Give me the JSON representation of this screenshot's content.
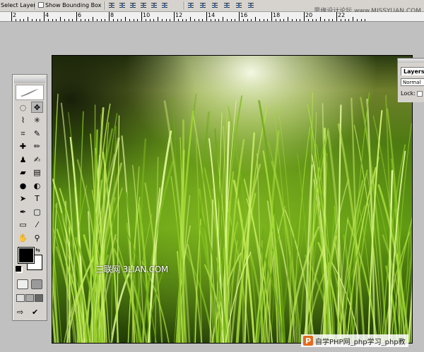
{
  "options_bar": {
    "select_layer_label": "Select Layer",
    "show_bounding_box_label": "Show Bounding Box"
  },
  "ruler": {
    "ticks": [
      "2",
      "4",
      "6",
      "8",
      "10",
      "12",
      "14",
      "16",
      "18",
      "20",
      "22"
    ]
  },
  "watermarks": {
    "top_right": "思缘设计论坛 www.MISSYUAN.COM",
    "canvas": "三联网 3LIAN.COM",
    "bottom_right": "自学PHP网_php学习_php教",
    "bottom_logo": "P"
  },
  "layers_panel": {
    "tab_label": "Layers",
    "blend_mode": "Normal",
    "lock_label": "Lock:"
  },
  "toolbox": {
    "tools": [
      {
        "name": "marquee-tool-icon",
        "glyph": "◌"
      },
      {
        "name": "move-tool-icon",
        "glyph": "✥"
      },
      {
        "name": "lasso-tool-icon",
        "glyph": "⌇"
      },
      {
        "name": "magic-wand-tool-icon",
        "glyph": "✳"
      },
      {
        "name": "crop-tool-icon",
        "glyph": "⌗"
      },
      {
        "name": "slice-tool-icon",
        "glyph": "✎"
      },
      {
        "name": "healing-brush-tool-icon",
        "glyph": "✚"
      },
      {
        "name": "brush-tool-icon",
        "glyph": "✏"
      },
      {
        "name": "clone-stamp-tool-icon",
        "glyph": "♟"
      },
      {
        "name": "history-brush-tool-icon",
        "glyph": "✍"
      },
      {
        "name": "eraser-tool-icon",
        "glyph": "▰"
      },
      {
        "name": "gradient-tool-icon",
        "glyph": "▤"
      },
      {
        "name": "blur-tool-icon",
        "glyph": "●"
      },
      {
        "name": "dodge-tool-icon",
        "glyph": "◐"
      },
      {
        "name": "path-selection-tool-icon",
        "glyph": "➤"
      },
      {
        "name": "type-tool-icon",
        "glyph": "T"
      },
      {
        "name": "pen-tool-icon",
        "glyph": "✒"
      },
      {
        "name": "shape-tool-icon",
        "glyph": "▢"
      },
      {
        "name": "notes-tool-icon",
        "glyph": "▭"
      },
      {
        "name": "eyedropper-tool-icon",
        "glyph": "⁄"
      },
      {
        "name": "hand-tool-icon",
        "glyph": "✋"
      },
      {
        "name": "zoom-tool-icon",
        "glyph": "⚲"
      }
    ],
    "foreground_color": "#000000",
    "background_color": "#ffffff"
  }
}
